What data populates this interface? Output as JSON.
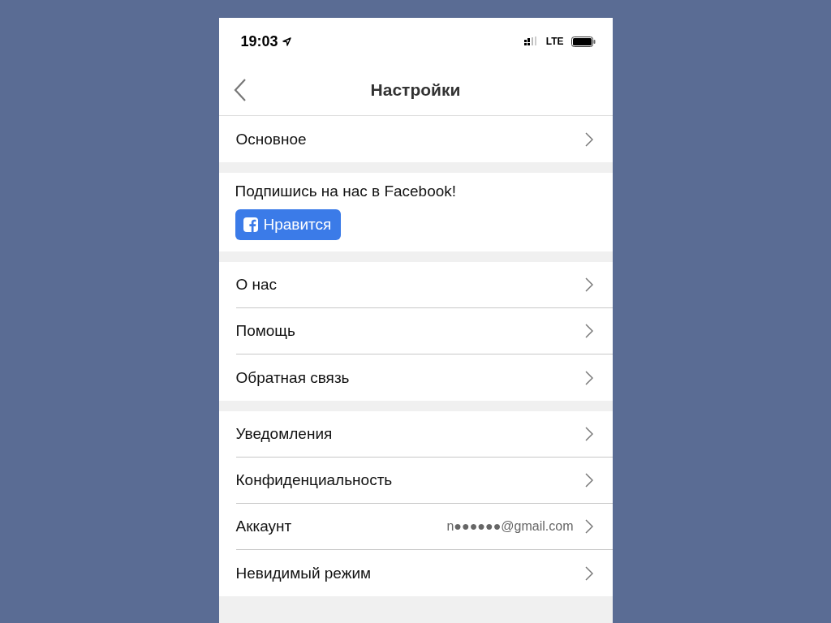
{
  "status_bar": {
    "time": "19:03",
    "network": "LTE"
  },
  "nav": {
    "title": "Настройки"
  },
  "sections": [
    {
      "kind": "links",
      "items": [
        {
          "label": "Основное"
        }
      ]
    },
    {
      "kind": "promo",
      "text": "Подпишись на нас в Facebook!",
      "button": "Нравится"
    },
    {
      "kind": "links",
      "items": [
        {
          "label": "О нас"
        },
        {
          "label": "Помощь"
        },
        {
          "label": "Обратная связь"
        }
      ]
    },
    {
      "kind": "links",
      "items": [
        {
          "label": "Уведомления"
        },
        {
          "label": "Конфиденциальность"
        },
        {
          "label": "Аккаунт",
          "value": "n●●●●●●@gmail.com"
        },
        {
          "label": "Невидимый режим"
        }
      ]
    }
  ]
}
